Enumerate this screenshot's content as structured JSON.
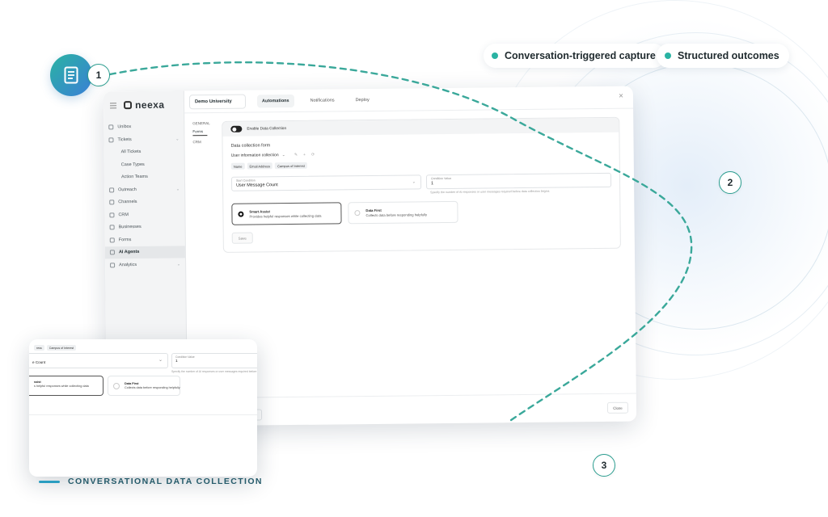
{
  "badges": [
    {
      "label": "Conversation-triggered capture"
    },
    {
      "label": "Structured outcomes"
    }
  ],
  "steps": [
    "1",
    "2",
    "3"
  ],
  "hero_icon": "document-icon",
  "colors": {
    "accent": "#2ab3a3",
    "dash": "#3aa89a",
    "caption": "#245a6a"
  },
  "app": {
    "brand": "neexa",
    "sidebar": [
      {
        "label": "Unibox",
        "type": "item"
      },
      {
        "label": "Tickets",
        "type": "item",
        "chevron": "⌄"
      },
      {
        "label": "All Tickets",
        "type": "sub"
      },
      {
        "label": "Case Types",
        "type": "sub"
      },
      {
        "label": "Action Teams",
        "type": "sub"
      },
      {
        "label": "Outreach",
        "type": "item",
        "chevron": "⌄"
      },
      {
        "label": "Channels",
        "type": "item"
      },
      {
        "label": "CRM",
        "type": "item"
      },
      {
        "label": "Businesses",
        "type": "item"
      },
      {
        "label": "Forms",
        "type": "item"
      },
      {
        "label": "AI Agents",
        "type": "active"
      },
      {
        "label": "Analytics",
        "type": "item",
        "chevron": "⌄"
      }
    ],
    "org": "Demo University",
    "tabs": [
      "Automations",
      "Notifications",
      "Deploy"
    ],
    "close_x": "×",
    "subnav": [
      "GENERAL",
      "Forms",
      "CRM"
    ],
    "toggle_label": "Enable Data Collection",
    "form_section_label": "Data collection form",
    "form_select": "User information collection",
    "form_select_chevron": "⌄",
    "form_icons": [
      "✎",
      "+",
      "⟳"
    ],
    "chips": [
      "Name",
      "Email Address",
      "Campus of Interest"
    ],
    "start_condition": {
      "caption": "Start Condition",
      "value": "User Message Count"
    },
    "condition_value": {
      "caption": "Condition Value",
      "value": "1"
    },
    "helper_text": "Specify the number of AI responses or user messages required before data collection begins",
    "modes": [
      {
        "title": "Smart Assist",
        "subtitle": "Provides helpful responses while collecting data",
        "selected": true
      },
      {
        "title": "Data First",
        "subtitle": "Collects data before responding helpfully",
        "selected": false
      }
    ],
    "save_label": "Save",
    "close_label": "Close"
  },
  "zoom": {
    "chips": [
      "ress",
      "Campus of Interest"
    ],
    "start_value": "e Count",
    "condition_caption": "Condition Value",
    "condition_value": "1",
    "helper_text": "Specify the number of AI responses or user messages required before",
    "mode1_title": "ssist",
    "mode1_sub": "s helpful responses while collecting data",
    "mode2_title": "Data First",
    "mode2_sub": "Collects data before responding helpfully"
  },
  "caption": "CONVERSATIONAL DATA COLLECTION"
}
